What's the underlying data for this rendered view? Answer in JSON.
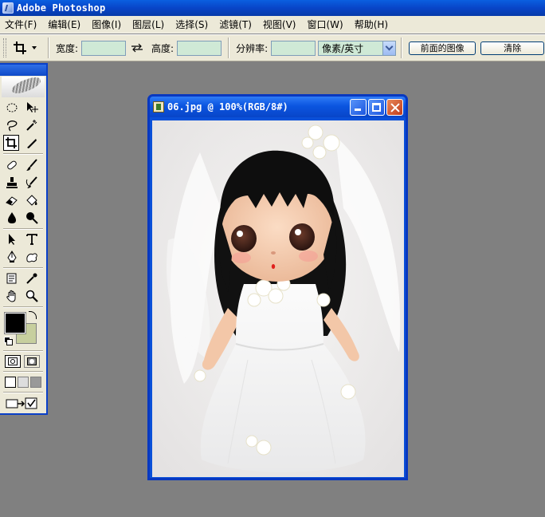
{
  "window": {
    "title": "Adobe Photoshop",
    "app_icon": "photoshop-feather-icon"
  },
  "menubar": {
    "items": [
      {
        "label": "文件(F)"
      },
      {
        "label": "编辑(E)"
      },
      {
        "label": "图像(I)"
      },
      {
        "label": "图层(L)"
      },
      {
        "label": "选择(S)"
      },
      {
        "label": "滤镜(T)"
      },
      {
        "label": "视图(V)"
      },
      {
        "label": "窗口(W)"
      },
      {
        "label": "帮助(H)"
      }
    ]
  },
  "options": {
    "width_label": "宽度:",
    "width_value": "",
    "height_label": "高度:",
    "height_value": "",
    "resolution_label": "分辨率:",
    "resolution_value": "",
    "units_selected": "像素/英寸",
    "front_image_button": "前面的图像",
    "clear_button": "清除"
  },
  "toolbox": {
    "foreground_color": "#000000",
    "background_color": "#c7cf9e",
    "active_tool": "crop-tool"
  },
  "document": {
    "title": "06.jpg @ 100%(RGB/8#)"
  },
  "colors": {
    "titlebar": "#0845c8",
    "chrome": "#ece9d8",
    "workspace": "#808080",
    "input_fill": "#cfe9d6"
  }
}
